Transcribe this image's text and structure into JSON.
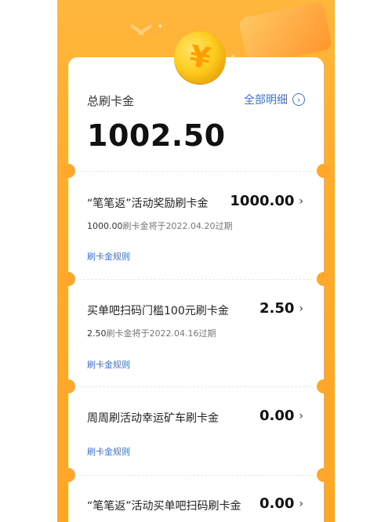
{
  "header": {
    "title": "总刷卡金",
    "details_link": "全部明细",
    "total": "1002.50"
  },
  "coin_symbol": "¥",
  "items": [
    {
      "title": "“笔笔返”活动奖励刷卡金",
      "amount": "1000.00",
      "sub_amount": "1000.00",
      "sub_text": "刷卡金将于2022.04.20过期",
      "rule_link": "刷卡金规则"
    },
    {
      "title": "买单吧扫码门槛100元刷卡金",
      "amount": "2.50",
      "sub_amount": "2.50",
      "sub_text": "刷卡金将于2022.04.16过期",
      "rule_link": "刷卡金规则"
    },
    {
      "title": "周周刷活动幸运矿车刷卡金",
      "amount": "0.00",
      "rule_link": "刷卡金规则"
    },
    {
      "title": "“笔笔返”活动买单吧扫码刷卡金",
      "amount": "0.00"
    }
  ],
  "icons": {
    "chevron": "›",
    "sparkle": "✦"
  },
  "colors": {
    "background_orange": "#ffab2d",
    "link_blue": "#3f72d6",
    "coin_gold": "#ffcd1f"
  }
}
